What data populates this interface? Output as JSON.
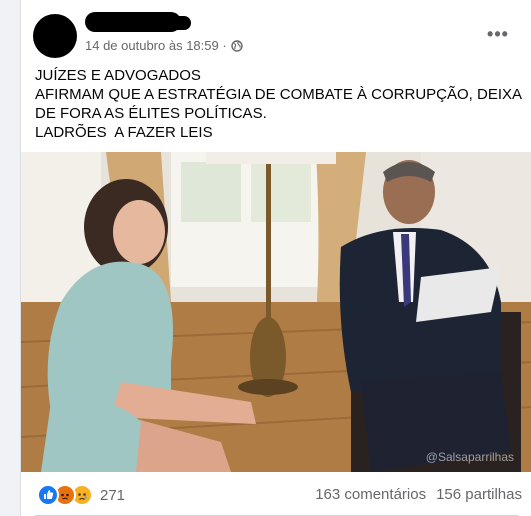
{
  "post": {
    "timestamp": "14 de outubro às 18:59 ·",
    "privacy_icon": "globe-icon",
    "more_icon": "more-options-icon",
    "text_lines": [
      "JUÍZES E ADVOGADOS",
      "AFIRMAM QUE A ESTRATÉGIA DE COMBATE À CORRUPÇÃO, DEIXA DE FORA AS ÉLITES POLÍTICAS.",
      "LADRÕES  A FAZER LEIS"
    ],
    "image_watermark": "@Salsaparrilhas"
  },
  "footer": {
    "reaction_icons": [
      "like-icon",
      "angry-icon",
      "sad-icon"
    ],
    "reaction_count": "271",
    "comments": "163 comentários",
    "shares": "156 partilhas"
  },
  "colors": {
    "like": "#1877f2",
    "angry": "#e9710f",
    "sad": "#f7b125",
    "meta_text": "#65676b"
  }
}
